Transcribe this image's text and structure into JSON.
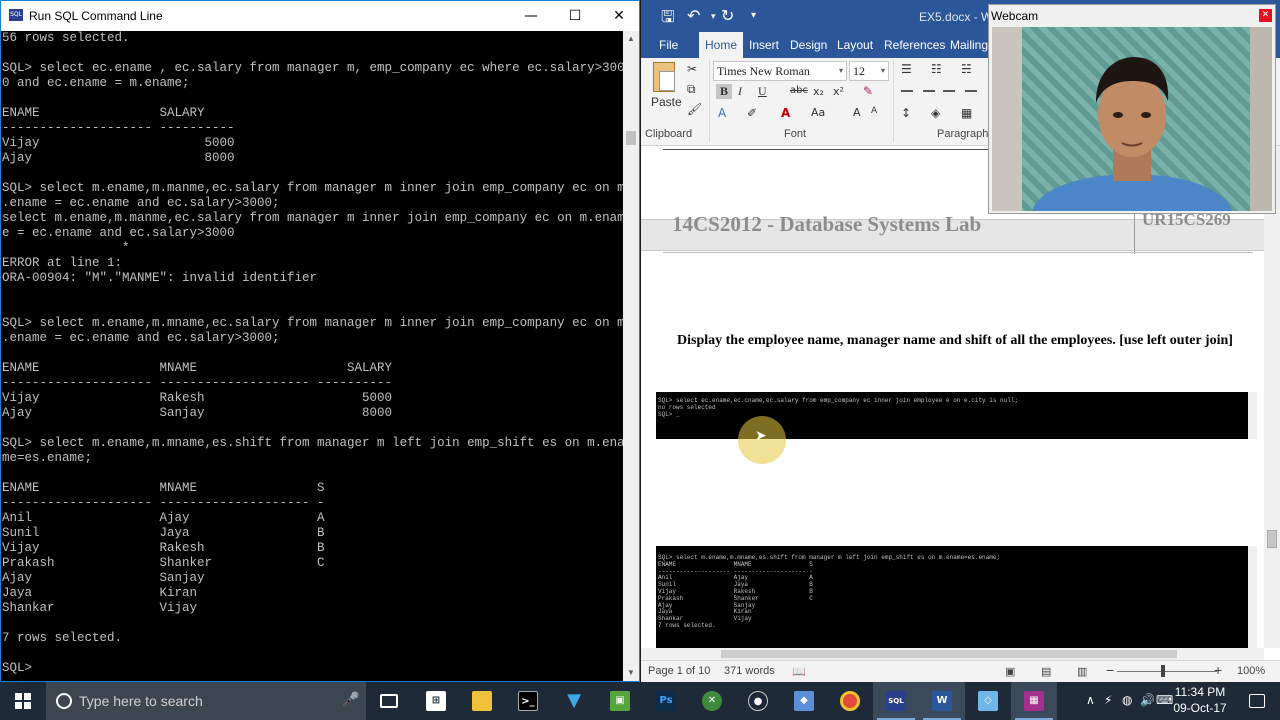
{
  "sql_window": {
    "title": "Run SQL Command Line",
    "lines": [
      "56 rows selected.",
      "",
      "SQL> select ec.ename , ec.salary from manager m, emp_company ec where ec.salary>300",
      "0 and ec.ename = m.ename;",
      "",
      "ENAME                SALARY",
      "-------------------- ----------",
      "Vijay                      5000",
      "Ajay                       8000",
      "",
      "SQL> select m.ename,m.manme,ec.salary from manager m inner join emp_company ec on m",
      ".ename = ec.ename and ec.salary>3000;",
      "select m.ename,m.manme,ec.salary from manager m inner join emp_company ec on m.enam",
      "e = ec.ename and ec.salary>3000",
      "                *",
      "ERROR at line 1:",
      "ORA-00904: \"M\".\"MANME\": invalid identifier",
      "",
      "",
      "SQL> select m.ename,m.mname,ec.salary from manager m inner join emp_company ec on m",
      ".ename = ec.ename and ec.salary>3000;",
      "",
      "ENAME                MNAME                    SALARY",
      "-------------------- -------------------- ----------",
      "Vijay                Rakesh                     5000",
      "Ajay                 Sanjay                     8000",
      "",
      "SQL> select m.ename,m.mname,es.shift from manager m left join emp_shift es on m.ena",
      "me=es.ename;",
      "",
      "ENAME                MNAME                S",
      "-------------------- -------------------- -",
      "Anil                 Ajay                 A",
      "Sunil                Jaya                 B",
      "Vijay                Rakesh               B",
      "Prakash              Shanker              C",
      "Ajay                 Sanjay",
      "Jaya                 Kiran",
      "Shankar              Vijay",
      "",
      "7 rows selected.",
      "",
      "SQL> "
    ]
  },
  "word": {
    "doc_title": "EX5.docx - Wo",
    "tabs": [
      "File",
      "Home",
      "Insert",
      "Design",
      "Layout",
      "References",
      "Mailing"
    ],
    "active_tab": "Home",
    "font_name": "Times New Roman",
    "font_size": "12",
    "groups": {
      "clipboard": "Clipboard",
      "font": "Font",
      "paragraph": "Paragraph"
    },
    "paste_label": "Paste",
    "header_title": "14CS2012 - Database Systems Lab",
    "header_code": "UR15CS269",
    "shot1_lines": [
      "SQL> select ec.ename,ec.cname,ec.salary from emp_company ec inner join employee e on e.city is null;",
      "no rows selected",
      "",
      "SQL> _"
    ],
    "question": "Display the employee name, manager name and shift of all the employees. [use left outer join]",
    "shot2_lines": [
      "SQL> select m.ename,m.mname,es.shift from manager m left join emp_shift es on m.ename=es.ename;",
      "",
      "ENAME                MNAME                S",
      "-------------------- -------------------- -",
      "Anil                 Ajay                 A",
      "Sunil                Jaya                 B",
      "Vijay                Rakesh               B",
      "Prakash              Shanker              C",
      "Ajay                 Sanjay",
      "Jaya                 Kiran",
      "Shankar              Vijay",
      "",
      "7 rows selected."
    ],
    "status": {
      "page": "Page 1 of 10",
      "words": "371 words",
      "zoom": "100%"
    }
  },
  "webcam": {
    "title": "Webcam",
    "close": "✕"
  },
  "taskbar": {
    "search_placeholder": "Type here to search",
    "time": "11:34 PM",
    "date": "09-Oct-17"
  },
  "colors": {
    "word_blue": "#2b579a",
    "console_bg": "#000000",
    "console_text": "#c0c0c0",
    "taskbar": "#1e2a38"
  }
}
